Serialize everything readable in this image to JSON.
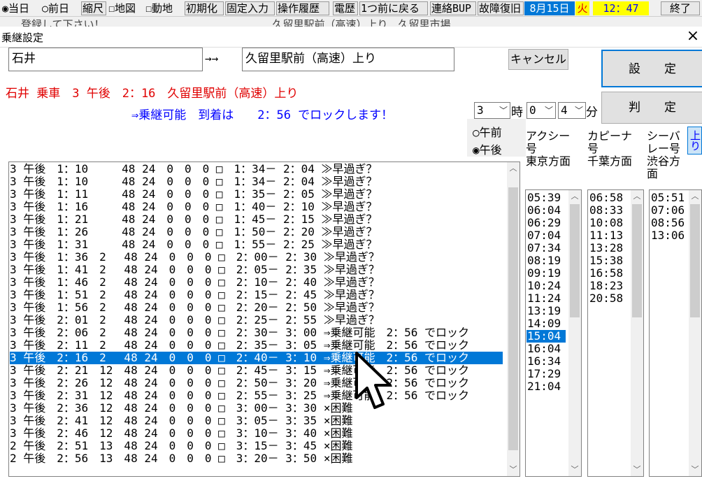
{
  "toolbar": {
    "radio_today": "当日",
    "radio_prevday": "前日",
    "scale": "縮尺",
    "map": "地図",
    "dynamic": "動地",
    "init": "初期化",
    "fixed_input": "固定入力",
    "op_history": "操作履歴",
    "telegram_history": "電歴",
    "back_one": "1つ前に戻る",
    "contact_bup": "連絡BUP",
    "fault_restore": "故障復旧",
    "date": "8月15日",
    "weekday": "火",
    "time": "12：47",
    "exit": "終了",
    "today_checked": true,
    "map_checked": false,
    "dynamic_checked": false
  },
  "background_strip": "　　登録して下さい！　　　　　　　　　　　　　　　　久留里駅前（高速）上り　久留里市場",
  "window": {
    "title": "乗継設定",
    "close_glyph": "×"
  },
  "form": {
    "from_station": "石井",
    "arrow": "→→",
    "to_station": "久留里駅前（高速）上り",
    "cancel_label": "キャンセル",
    "set_label": "設　　定",
    "judge_label": "判　　定",
    "summary": "石井 乗車　3 午後　2：16　久留里駅前（高速）上り",
    "result": "⇒乗継可能　到着は　　2：56 でロックします！",
    "hour_value": "3",
    "hour_unit": "時",
    "minute_tens": "0",
    "minute_ones": "4",
    "minute_unit": "分",
    "am_label": "午前",
    "pm_label": "午後",
    "pm_selected": true
  },
  "schedule": {
    "rows": [
      "3 午後　1：10　　　48 24　0　0　0 □　1：34－ 2：04 ≫早過ぎ？",
      "3 午後　1：10　　　48 24　0　0　0 □　1：34－ 2：04 ≫早過ぎ？",
      "3 午後　1：11　　　48 24　0　0　0 □　1：35－ 2：05 ≫早過ぎ？",
      "3 午後　1：16　　　48 24　0　0　0 □　1：40－ 2：10 ≫早過ぎ？",
      "3 午後　1：21　　　48 24　0　0　0 □　1：45－ 2：15 ≫早過ぎ？",
      "3 午後　1：26　　　48 24　0　0　0 □　1：50－ 2：20 ≫早過ぎ？",
      "3 午後　1：31　　　48 24　0　0　0 □　1：55－ 2：25 ≫早過ぎ？",
      "3 午後　1：36　2　 48 24　0　0　0 □　2：00－ 2：30 ≫早過ぎ？",
      "3 午後　1：41　2　 48 24　0　0　0 □　2：05－ 2：35 ≫早過ぎ？",
      "3 午後　1：46　2　 48 24　0　0　0 □　2：10－ 2：40 ≫早過ぎ？",
      "3 午後　1：51　2　 48 24　0　0　0 □　2：15－ 2：45 ≫早過ぎ？",
      "3 午後　1：56　2　 48 24　0　0　0 □　2：20－ 2：50 ≫早過ぎ？",
      "3 午後　2：01　2　 48 24　0　0　0 □　2：25－ 2：55 ≫早過ぎ？",
      "3 午後　2：06　2　 48 24　0　0　0 □　2：30－ 3：00 ⇒乗継可能　2：56 でロック",
      "3 午後　2：11　2　 48 24　0　0　0 □　2：35－ 3：05 ⇒乗継可能　2：56 でロック",
      "3 午後　2：16　2　 48 24　0　0　0 □　2：40－ 3：10 ⇒乗継可能　2：56 でロック",
      "3 午後　2：21　12　48 24　0　0　0 □　2：45－ 3：15 ⇒乗継可能　2：56 でロック",
      "3 午後　2：26　12　48 24　0　0　0 □　2：50－ 3：20 ⇒乗継可能　2：56 でロック",
      "3 午後　2：31　12　48 24　0　0　0 □　2：55－ 3：25 ⇒乗継可能　2：56 でロック",
      "3 午後　2：36　12　48 24　0　0　0 □　3：00－ 3：30 ×困難",
      "3 午後　2：41　12　48 24　0　0　0 □　3：05－ 3：35 ×困難",
      "3 午後　2：46　12　48 24　0　0　0 □　3：10－ 3：40 ×困難",
      "2 午後　2：51　13　48 24　0　0　0 □　3：15－ 3：45 ×困難",
      "2 午後　2：56　13　48 24　0　0　0 □　3：20－ 3：50 ×困難"
    ],
    "selected_row": "3 午後　2：16　2　 48 24　0　0　0 □　2：40－ 3：10 ⇒乗継可能　2：56 でロック"
  },
  "timetables": {
    "col1": {
      "header_line1": "アクシー",
      "header_line2": "号",
      "header_line3": "東京方面",
      "times_before": [
        "05:39",
        "06:04",
        "06:29",
        "07:04",
        "07:34",
        "08:19",
        "09:19",
        "10:24",
        "11:24",
        "13:19",
        "14:09"
      ],
      "times_selected": "15:04",
      "times_after": [
        "16:04",
        "16:34",
        "17:29",
        "21:04"
      ]
    },
    "col2": {
      "header_line1": "カピーナ",
      "header_line2": "号",
      "header_line3": "千葉方面",
      "times": [
        "06:58",
        "08:33",
        "10:08",
        "11:13",
        "13:28",
        "15:38",
        "16:58",
        "18:23",
        "20:58"
      ]
    },
    "col3": {
      "header_line1": "シーバ",
      "header_line2": "レー号",
      "header_line3": "渋谷方",
      "header_line4": "面",
      "times": [
        "05:51",
        "07:06",
        "08:56",
        "13:06"
      ]
    },
    "direction_tab": "上り"
  },
  "colors": {
    "summary_text": "#e00000",
    "result_text": "#0000ff",
    "selection": "#0078d7",
    "date_bg": "#0078d7",
    "weekday_bg": "#ffff00",
    "time_bg": "#ffff00",
    "time_text": "#0000ff"
  }
}
